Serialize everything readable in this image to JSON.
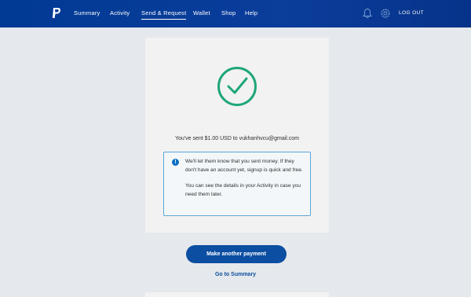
{
  "nav": {
    "items": [
      {
        "label": "Summary"
      },
      {
        "label": "Activity"
      },
      {
        "label": "Send & Request"
      },
      {
        "label": "Wallet"
      },
      {
        "label": "Shop"
      },
      {
        "label": "Help"
      }
    ],
    "active": "Send & Request",
    "logout_label": "LOG OUT"
  },
  "icons": {
    "logo": "paypal-logo",
    "notifications": "bell-icon",
    "settings": "gear-icon",
    "success": "checkmark-circle-icon",
    "info": "info-icon"
  },
  "confirmation": {
    "message": "You've sent $1.00 USD to vukhanhvcu@gmail.com"
  },
  "info": {
    "line1": "We'll let them know that you sent money. If they don't have an account yet, signup is quick and free.",
    "line2": "You can see the details in your Activity in case you need them later."
  },
  "actions": {
    "primary_label": "Make another payment",
    "link_label": "Go to Summary"
  },
  "colors": {
    "header": "#003a94",
    "success": "#1fa67a",
    "primary": "#0b4ea2",
    "info_border": "#5aa7d8"
  }
}
